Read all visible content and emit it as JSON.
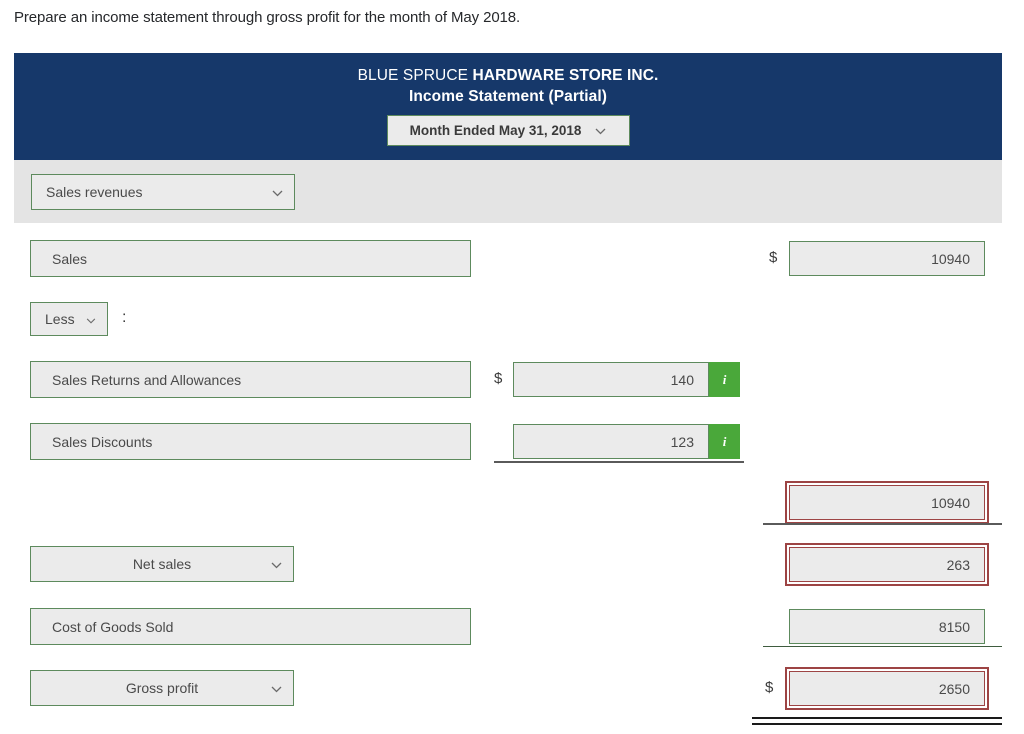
{
  "prompt": "Prepare an income statement through gross profit for the month of May 2018.",
  "statement": {
    "company_regular": "BLUE SPRUCE ",
    "company_bold": "HARDWARE STORE INC.",
    "subtitle": "Income Statement (Partial)",
    "period_select": {
      "value": "Month Ended May 31, 2018",
      "caret": "chevron-down-icon"
    },
    "section_header": {
      "value": "Sales revenues"
    },
    "rows": {
      "sales": {
        "label": "Sales",
        "currency": "$",
        "amount": "10940"
      },
      "less": {
        "value": "Less",
        "colon": ":"
      },
      "returns": {
        "label": "Sales Returns and Allowances",
        "currency": "$",
        "amount": "140",
        "info": "i"
      },
      "discounts": {
        "label": "Sales Discounts",
        "amount": "123",
        "info": "i"
      },
      "deductions_total": {
        "amount": "10940"
      },
      "net_sales": {
        "label": "Net sales",
        "amount": "263"
      },
      "cogs": {
        "label": "Cost of Goods Sold",
        "amount": "8150"
      },
      "gross_profit": {
        "label": "Gross profit",
        "currency": "$",
        "amount": "2650"
      }
    }
  },
  "colors": {
    "header_blue": "#16386a",
    "band_gray": "#e4e4e4",
    "field_green": "#5d8a5d",
    "info_green": "#4aa83a",
    "error_red": "#9d4444"
  }
}
